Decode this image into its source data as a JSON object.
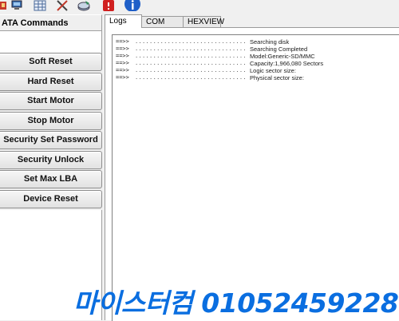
{
  "toolbar": {
    "icons": [
      "toolbar-icon-1",
      "computer-icon",
      "grid-icon",
      "tools-icon",
      "drive-icon",
      "stop-icon",
      "info-icon"
    ],
    "colors": {
      "info": "#1f5fc8",
      "stop": "#d02020"
    }
  },
  "left_panel": {
    "header": "ATA Commands",
    "buttons": [
      "Soft Reset",
      "Hard Reset",
      "Start Motor",
      "Stop Motor",
      "Security Set Password",
      "Security Unlock",
      "Set Max LBA",
      "Device Reset"
    ]
  },
  "tabs": [
    "Logs",
    "COM",
    "HEXVIEW"
  ],
  "active_tab": "Logs",
  "log": {
    "arrow": "==>>",
    "dots": "..............................................",
    "lines": [
      "Searching disk",
      "Searching Completed",
      "Model:Generic-SD/MMC",
      "Capacity:1,966,080 Sectors",
      "Logic sector size:",
      "Physical sector size:"
    ]
  },
  "watermark": "마이스터컴 01052459228",
  "colors": {
    "watermark": "#0a6ee0",
    "panel": "#f0f0f0"
  }
}
